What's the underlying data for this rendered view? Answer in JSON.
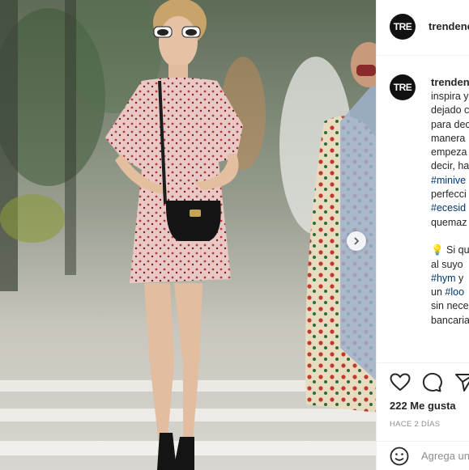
{
  "post": {
    "username": "trendencias",
    "avatar_text": "TRE",
    "caption_lines": [
      {
        "text": "inspira y"
      },
      {
        "text": "dejado c"
      },
      {
        "text": "para dec"
      },
      {
        "text": "manera"
      },
      {
        "text": "empeza"
      },
      {
        "text": "decir, ha"
      },
      {
        "text": "#minive",
        "tag": true
      },
      {
        "text": "perfecci"
      },
      {
        "text": "#ecesid",
        "tag": true
      },
      {
        "text": "quemaz"
      },
      {
        "text": ""
      },
      {
        "text": "💡 Si qu"
      },
      {
        "text": "al suyo"
      },
      {
        "text": "#hym y",
        "mixed": true
      },
      {
        "text": "un #loo",
        "mixed2": true
      },
      {
        "text": "sin nece"
      },
      {
        "text": "bancaria"
      }
    ],
    "likes_text": "222 Me gusta",
    "time_ago": "HACE 2 DÍAS",
    "comment_placeholder": "Agrega un comentario..."
  },
  "icons": {
    "like": "heart-icon",
    "comment": "comment-icon",
    "share": "share-icon",
    "emoji": "emoji-icon",
    "next": "chevron-right-icon"
  },
  "colors": {
    "link": "#00376b",
    "text": "#262626",
    "muted": "#8e8e8e",
    "border": "#efefef"
  }
}
